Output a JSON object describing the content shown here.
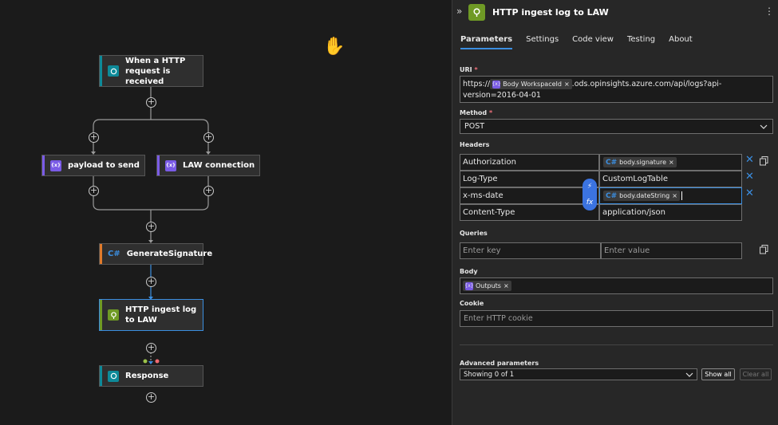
{
  "canvas": {
    "nodes": {
      "trigger": {
        "label": "When a HTTP request is received",
        "icon": "http-request-icon"
      },
      "payload": {
        "label": "payload to send",
        "icon": "variable-icon"
      },
      "law_connection": {
        "label": "LAW connection",
        "icon": "variable-icon"
      },
      "generate": {
        "label": "GenerateSignature",
        "icon": "csharp-icon"
      },
      "http_ingest": {
        "label": "HTTP ingest log to LAW",
        "icon": "http-icon"
      },
      "response": {
        "label": "Response",
        "icon": "http-request-icon"
      }
    },
    "add_symbol": "+",
    "hand_cursor": "✋"
  },
  "panel": {
    "title": "HTTP ingest log to LAW",
    "collapse_glyph": "»",
    "more_glyph": "⋮",
    "tabs": [
      {
        "label": "Parameters",
        "active": true
      },
      {
        "label": "Settings",
        "active": false
      },
      {
        "label": "Code view",
        "active": false
      },
      {
        "label": "Testing",
        "active": false
      },
      {
        "label": "About",
        "active": false
      }
    ],
    "uri": {
      "label": "URI",
      "required": "*",
      "prefix": "https://",
      "token": "Body WorkspaceId",
      "suffix": ".ods.opinsights.azure.com/api/logs?api-version=2016-04-01"
    },
    "method": {
      "label": "Method",
      "required": "*",
      "value": "POST"
    },
    "headers": {
      "label": "Headers",
      "rows": [
        {
          "key": "Authorization",
          "value": "",
          "token": "body.signature",
          "token_icon": "csharp"
        },
        {
          "key": "Log-Type",
          "value": "CustomLogTable",
          "token": "",
          "token_icon": ""
        },
        {
          "key": "x-ms-date",
          "value": "",
          "token": "body.dateString",
          "token_icon": "csharp"
        },
        {
          "key": "Content-Type",
          "value": "application/json",
          "token": "",
          "token_icon": ""
        }
      ]
    },
    "queries": {
      "label": "Queries",
      "key_placeholder": "Enter key",
      "value_placeholder": "Enter value"
    },
    "body": {
      "label": "Body",
      "token": "Outputs"
    },
    "cookie": {
      "label": "Cookie",
      "placeholder": "Enter HTTP cookie"
    },
    "advanced": {
      "label": "Advanced parameters",
      "select_value": "Showing 0 of 1",
      "show_all": "Show all",
      "clear_all": "Clear all"
    },
    "token_x": "×",
    "remove_x": "✕",
    "csharp_glyph": "C#",
    "var_glyph": "{x}",
    "fx_top": "⚡",
    "fx_bottom": "fx"
  },
  "colors": {
    "accent": "#3b8ee0",
    "variable": "#7a5be6",
    "http": "#6f9a25",
    "trigger": "#0e8a99",
    "required": "#f1707b"
  }
}
